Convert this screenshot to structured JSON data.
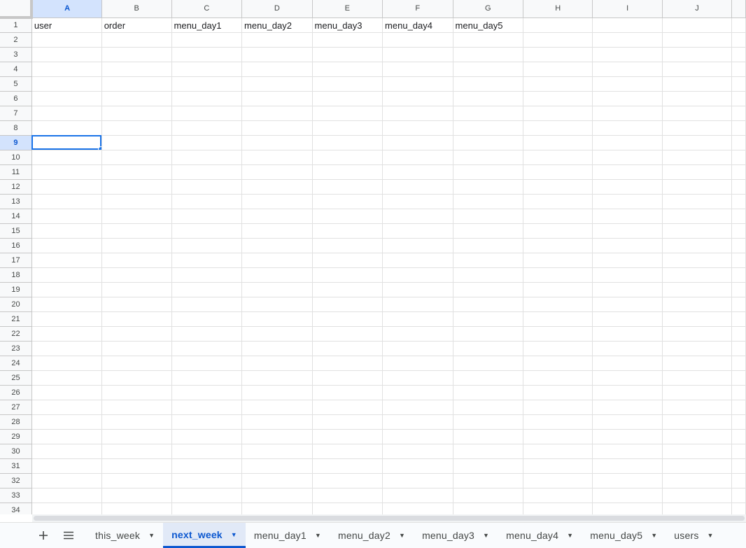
{
  "columns": [
    "A",
    "B",
    "C",
    "D",
    "E",
    "F",
    "G",
    "H",
    "I",
    "J"
  ],
  "active_column": "A",
  "active_row": 9,
  "row_count": 34,
  "header_row": [
    "user",
    "order",
    "menu_day1",
    "menu_day2",
    "menu_day3",
    "menu_day4",
    "menu_day5",
    "",
    "",
    ""
  ],
  "icons": {
    "add": "plus-icon",
    "list": "hamburger-menu-icon",
    "tab_menu": "caret-down-icon"
  },
  "colors": {
    "accent": "#0b57d0",
    "selection": "#1a73e8",
    "active_header_bg": "#d3e3fd"
  },
  "tabs": [
    {
      "label": "this_week",
      "active": false
    },
    {
      "label": "next_week",
      "active": true
    },
    {
      "label": "menu_day1",
      "active": false
    },
    {
      "label": "menu_day2",
      "active": false
    },
    {
      "label": "menu_day3",
      "active": false
    },
    {
      "label": "menu_day4",
      "active": false
    },
    {
      "label": "menu_day5",
      "active": false
    },
    {
      "label": "users",
      "active": false
    }
  ]
}
